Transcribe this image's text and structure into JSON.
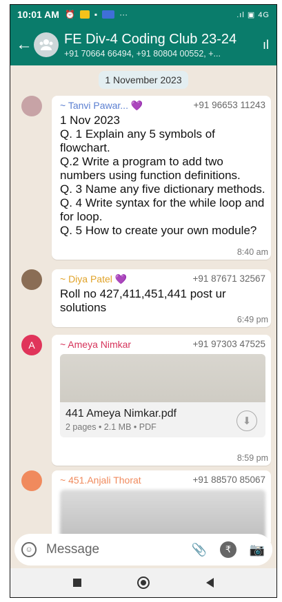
{
  "status_bar": {
    "time": "10:01 AM",
    "dots": "···",
    "network": "4G"
  },
  "header": {
    "title": "FE Div-4 Coding Club 23-24",
    "subtitle": "+91 70664 66494, +91 80804 00552, +..."
  },
  "date_chip": "1 November 2023",
  "messages": [
    {
      "sender": "~ Tanvi Pawar... 💜",
      "sender_color": "#5b7fd1",
      "phone": "+91 96653 11243",
      "lines": [
        "1 Nov 2023",
        "Q. 1 Explain any 5 symbols of flowchart.",
        "Q.2 Write a program to add two numbers using function definitions.",
        "Q. 3 Name any five dictionary methods.",
        "Q. 4 Write syntax for the while loop and for loop.",
        "Q. 5 How to create your own module?"
      ],
      "time": "8:40 am"
    },
    {
      "sender": "~ Diya Patel 💜",
      "sender_color": "#e0a227",
      "phone": "+91 87671 32567",
      "lines": [
        "Roll no 427,411,451,441 post ur solutions"
      ],
      "time": "6:49 pm"
    },
    {
      "sender": "~ Ameya Nimkar",
      "sender_color": "#d6335a",
      "phone": "+91 97303 47525",
      "avatar_letter": "A",
      "file_name": "441 Ameya Nimkar.pdf",
      "file_meta": "2 pages • 2.1 MB • PDF",
      "time": "8:59 pm"
    },
    {
      "sender": "~ 451.Anjali Thorat",
      "sender_color": "#f08a5d",
      "phone": "+91 88570 85067"
    }
  ],
  "input": {
    "placeholder": "Message"
  },
  "colors": {
    "header": "#0a7c6b",
    "chat_bg": "#efe7dd"
  }
}
